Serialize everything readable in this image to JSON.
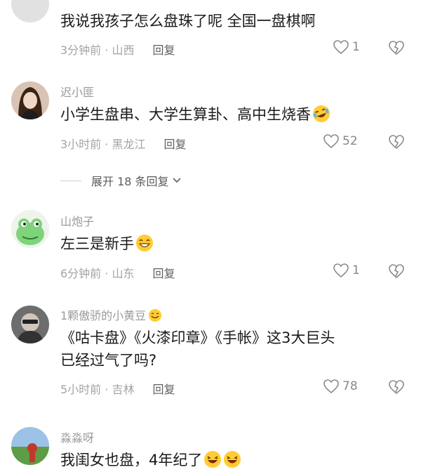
{
  "comments": [
    {
      "username": "",
      "text": "我说我孩子怎么盘珠了呢 全国一盘棋啊",
      "time": "3分钟前",
      "location": "山西",
      "reply": "回复",
      "likes": "1"
    },
    {
      "username": "迟小匪",
      "text": "小学生盘串、大学生算卦、高中生烧香",
      "text_emoji": "laughing-tears-emoji",
      "time": "3小时前",
      "location": "黑龙江",
      "reply": "回复",
      "likes": "52",
      "expand_label": "展开 18 条回复"
    },
    {
      "username": "山炮子",
      "text": "左三是新手",
      "text_emoji": "grinning-emoji",
      "time": "6分钟前",
      "location": "山东",
      "reply": "回复",
      "likes": "1"
    },
    {
      "username": "1颗傲骄的小黄豆",
      "username_emoji": "smile-emoji",
      "text_line1": "《咕卡盘》《火漆印章》《手帐》这3大巨头",
      "text_line2": "已经过气了吗?",
      "time": "5小时前",
      "location": "吉林",
      "reply": "回复",
      "likes": "78"
    },
    {
      "username": "淼淼呀",
      "text": "我闺女也盘，4年纪了",
      "text_emoji": "laughing-emoji",
      "time": "",
      "location": "",
      "reply": "",
      "likes": ""
    }
  ],
  "meta_separator": " · ",
  "colors": {
    "text": "#1a1a1a",
    "secondary": "#a3a3a3",
    "reply": "#5f5f5f"
  }
}
